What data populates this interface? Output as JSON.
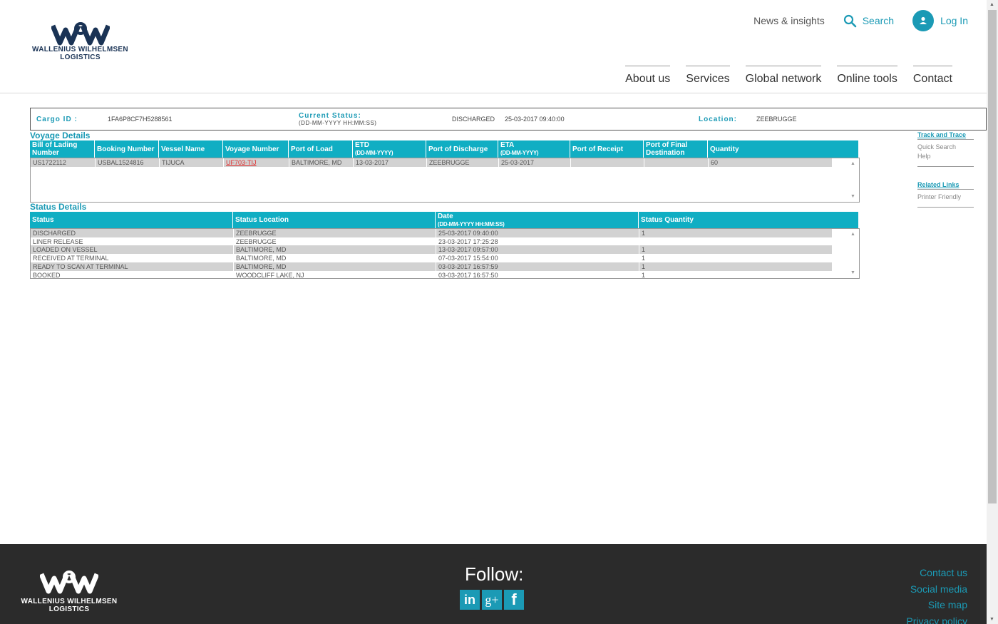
{
  "brand": {
    "name_line1": "WALLENIUS WILHELMSEN",
    "name_line2": "LOGISTICS",
    "mark": "W&W"
  },
  "header": {
    "news_link": "News & insights",
    "search_link": "Search",
    "login_link": "Log In",
    "nav": [
      "About us",
      "Services",
      "Global network",
      "Online tools",
      "Contact"
    ]
  },
  "cargo": {
    "cargo_id_label": "Cargo ID :",
    "cargo_id_value": "1FA6P8CF7H5288561",
    "status_label": "Current Status:",
    "status_format": "(DD-MM-YYYY HH:MM:SS)",
    "status_value": "DISCHARGED",
    "status_datetime": "25-03-2017 09:40:00",
    "location_label": "Location:",
    "location_value": "ZEEBRUGGE"
  },
  "voyage": {
    "title": "Voyage Details",
    "columns": [
      {
        "label": "Bill of Lading Number",
        "sub": ""
      },
      {
        "label": "Booking Number",
        "sub": ""
      },
      {
        "label": "Vessel Name",
        "sub": ""
      },
      {
        "label": "Voyage Number",
        "sub": ""
      },
      {
        "label": "Port of Load",
        "sub": ""
      },
      {
        "label": "ETD",
        "sub": "(DD-MM-YYYY)"
      },
      {
        "label": "Port of Discharge",
        "sub": ""
      },
      {
        "label": "ETA",
        "sub": "(DD-MM-YYYY)"
      },
      {
        "label": "Port of Receipt",
        "sub": ""
      },
      {
        "label": "Port of Final Destination",
        "sub": ""
      },
      {
        "label": "Quantity",
        "sub": ""
      }
    ],
    "rows": [
      [
        "US1722112",
        "USBAL1524816",
        "TIJUCA",
        "UF703-TIJ",
        "BALTIMORE, MD",
        "13-03-2017",
        "ZEEBRUGGE",
        "25-03-2017",
        "",
        "",
        "60"
      ]
    ]
  },
  "status": {
    "title": "Status Details",
    "columns": [
      {
        "label": "Status",
        "sub": ""
      },
      {
        "label": "Status Location",
        "sub": ""
      },
      {
        "label": "Date",
        "sub": "(DD-MM-YYYY HH:MM:SS)"
      },
      {
        "label": "Status Quantity",
        "sub": ""
      }
    ],
    "rows": [
      [
        "DISCHARGED",
        "ZEEBRUGGE",
        "25-03-2017 09:40:00",
        "1"
      ],
      [
        "LINER RELEASE",
        "ZEEBRUGGE",
        "23-03-2017 17:25:28",
        ""
      ],
      [
        "LOADED ON VESSEL",
        "BALTIMORE, MD",
        "13-03-2017 09:57:00",
        "1"
      ],
      [
        "RECEIVED AT TERMINAL",
        "BALTIMORE, MD",
        "07-03-2017 15:54:00",
        "1"
      ],
      [
        "READY TO SCAN AT TERMINAL",
        "BALTIMORE, MD",
        "03-03-2017 16:57:59",
        "1"
      ],
      [
        "BOOKED",
        "WOODCLIFF LAKE, NJ",
        "03-03-2017 16:57:50",
        "1"
      ]
    ]
  },
  "side": {
    "track_head": "Track and Trace",
    "track_items": [
      "Quick Search",
      "Help"
    ],
    "related_head": "Related Links",
    "related_items": [
      "Printer Friendly"
    ]
  },
  "footer": {
    "follow": "Follow:",
    "social": [
      {
        "icon": "linkedin-icon",
        "glyph": "in"
      },
      {
        "icon": "google-plus-icon",
        "glyph": "g+"
      },
      {
        "icon": "facebook-icon",
        "glyph": "f"
      }
    ],
    "links": [
      "Contact us",
      "Social media",
      "Site map",
      "Privacy policy"
    ]
  },
  "colors": {
    "accent": "#1b9ab5",
    "table_header": "#10aec3",
    "footer_bg": "#2b2b2b",
    "link_red": "#e03030"
  }
}
